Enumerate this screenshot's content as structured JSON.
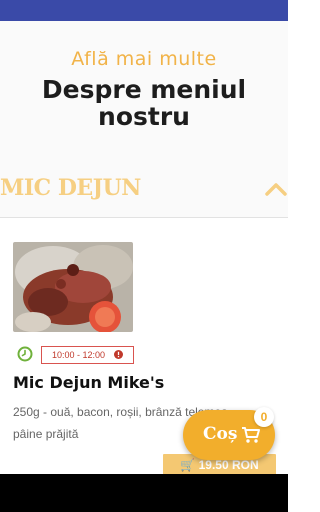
{
  "header": {
    "subtitle": "Află mai multe",
    "title": "Despre meniul nostru"
  },
  "section": {
    "title": "MIC DEJUN",
    "chevron_icon": "chevron-up-icon"
  },
  "menu_items": [
    {
      "time": "10:00 - 12:00",
      "name": "Mic Dejun Mike's",
      "description": "250g - ouă, bacon, roșii, brânză telemea, pâine prăjită",
      "price": "19.50 RON"
    }
  ],
  "cart": {
    "label": "Coș",
    "count": "0"
  },
  "colors": {
    "accent": "#f2ae2c",
    "status_bar": "#3a4aa8",
    "time_badge": "#d9534f"
  }
}
